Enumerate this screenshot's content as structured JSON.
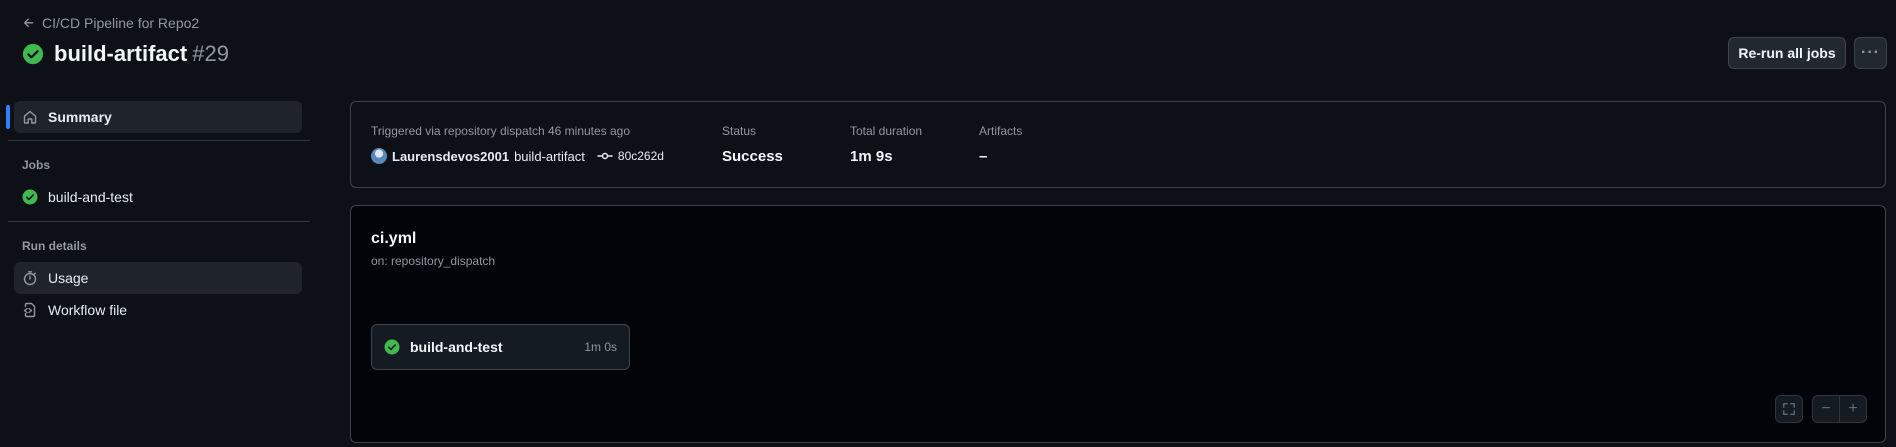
{
  "header": {
    "back_label": "CI/CD Pipeline for Repo2",
    "title": "build-artifact",
    "run_number": "#29",
    "rerun_label": "Re-run all jobs",
    "more_label": "···"
  },
  "sidebar": {
    "summary_label": "Summary",
    "jobs_heading": "Jobs",
    "jobs": [
      {
        "label": "build-and-test",
        "status": "success"
      }
    ],
    "run_details_heading": "Run details",
    "usage_label": "Usage",
    "workflow_file_label": "Workflow file"
  },
  "summary": {
    "trigger_label": "Triggered via repository dispatch 46 minutes ago",
    "actor": "Laurensdevos2001",
    "branch": "build-artifact",
    "commit": "80c262d",
    "status_label": "Status",
    "status_value": "Success",
    "duration_label": "Total duration",
    "duration_value": "1m 9s",
    "artifacts_label": "Artifacts",
    "artifacts_value": "–"
  },
  "graph": {
    "workflow_name": "ci.yml",
    "trigger": "on: repository_dispatch",
    "job": {
      "name": "build-and-test",
      "duration": "1m 0s"
    },
    "zoom_out_label": "−",
    "zoom_in_label": "+"
  },
  "colors": {
    "success": "#3fb950",
    "accent": "#2f81f7",
    "background": "#0d1117"
  }
}
